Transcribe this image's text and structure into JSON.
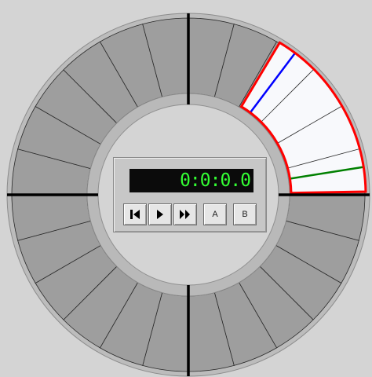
{
  "time_display": "0:0:0.0",
  "transport": {
    "rewind_icon": "skip-to-start-icon",
    "play_icon": "play-icon",
    "fast_forward_icon": "fast-forward-icon",
    "a_label": "A",
    "b_label": "B"
  },
  "dial": {
    "segment_count": 24,
    "colors": {
      "segment_fill": "#9e9e9e",
      "selected_fill": "#f8f9fc",
      "selection_border": "#ff0000",
      "marker_a": "#0000ff",
      "marker_b": "#008000",
      "divider": "#000000",
      "hub": "#d4d4d4"
    }
  }
}
